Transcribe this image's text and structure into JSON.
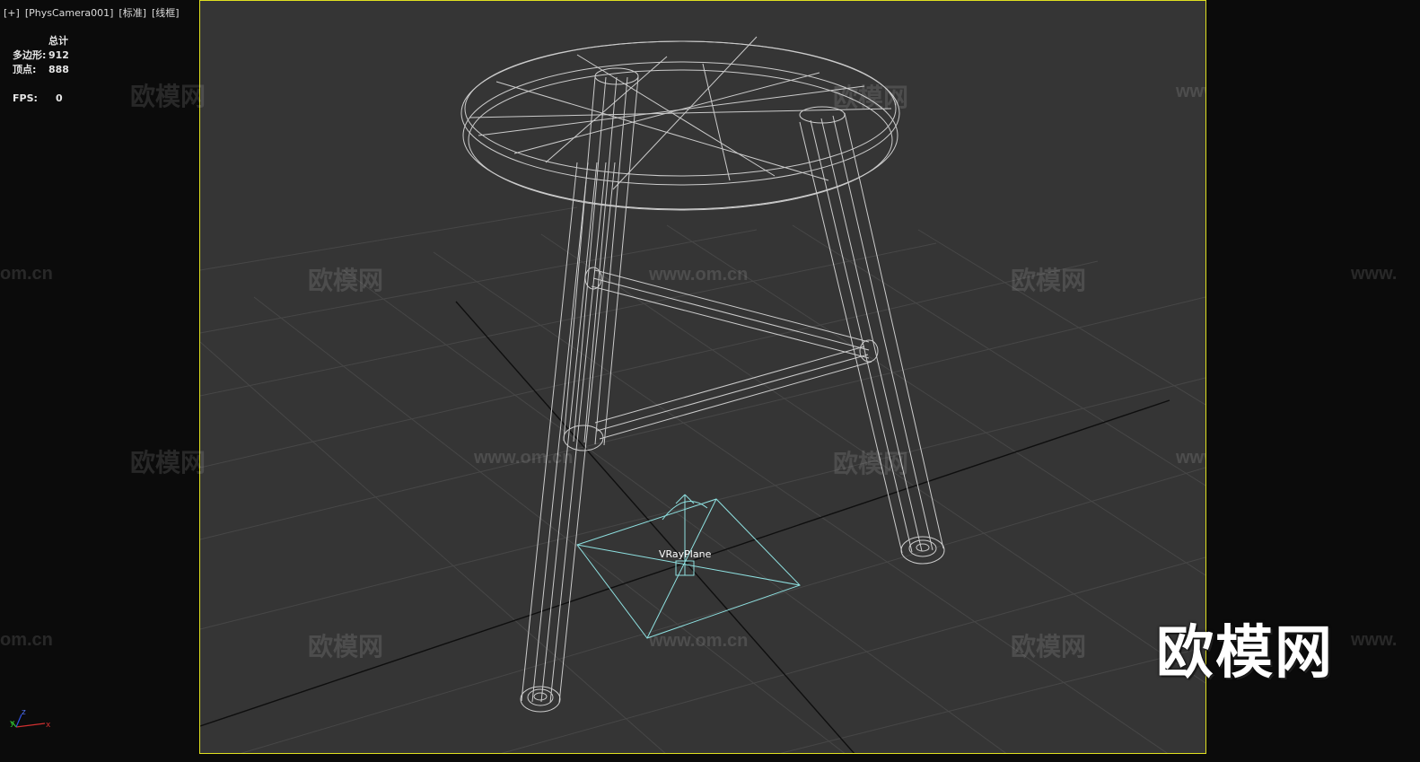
{
  "viewport_label": {
    "plus": "[+]",
    "camera": "[PhysCamera001]",
    "shading": "[标准]",
    "mode": "[线框]"
  },
  "stats": {
    "header": "总计",
    "polygons_label": "多边形:",
    "polygons_value": "912",
    "vertices_label": "顶点:",
    "vertices_value": "888",
    "fps_label": "FPS:",
    "fps_value": "0"
  },
  "scene": {
    "object_label": "VRayPlane",
    "wireframe_color": "#e8e8e8",
    "helper_color": "#8ee0e0",
    "viewport_border_color": "#e0e020",
    "viewport_bg": "#353535"
  },
  "watermarks": {
    "cn": "欧模网",
    "url": "www.om.cn",
    "url_partial_left": "om.cn",
    "url_partial_right": "www."
  },
  "big_logo": "欧模网",
  "axis": {
    "x": "x",
    "y": "y",
    "z": "z"
  }
}
